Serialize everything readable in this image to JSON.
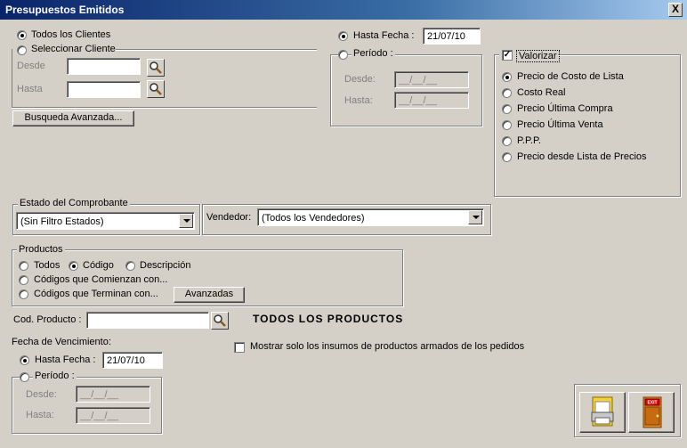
{
  "window": {
    "title": "Presupuestos Emitidos",
    "close_label": "X"
  },
  "cliente": {
    "todos_label": "Todos los Clientes",
    "seleccionar_label": "Seleccionar Cliente",
    "desde_label": "Desde",
    "hasta_label": "Hasta",
    "desde_value": "",
    "hasta_value": "",
    "busqueda_button": "Busqueda Avanzada..."
  },
  "fecha": {
    "hasta_fecha_label": "Hasta Fecha :",
    "hasta_fecha_value": "21/07/10",
    "periodo_label": "Período :",
    "desde_label": "Desde:",
    "hasta_label": "Hasta:",
    "desde_value": "__/__/__",
    "hasta_value": "__/__/__"
  },
  "valorizar": {
    "label": "Valorizar",
    "checked": true,
    "options": [
      "Precio de Costo de Lista",
      "Costo Real",
      "Precio Última Compra",
      "Precio Última Venta",
      "P.P.P.",
      "Precio desde Lista de Precios"
    ],
    "selected": "Precio de Costo de Lista"
  },
  "estado": {
    "label": "Estado del Comprobante",
    "value": "(Sin Filtro Estados)"
  },
  "vendedor": {
    "label": "Vendedor:",
    "value": "(Todos los Vendedores)"
  },
  "productos": {
    "label": "Productos",
    "todos_label": "Todos",
    "codigo_label": "Código",
    "descripcion_label": "Descripción",
    "comienzan_label": "Códigos que Comienzan con...",
    "terminan_label": "Códigos que Terminan con...",
    "avanzadas_button": "Avanzadas",
    "selected": "Código"
  },
  "cod_producto": {
    "label": "Cod. Producto :",
    "value": "",
    "banner": "TODOS LOS PRODUCTOS"
  },
  "vencimiento": {
    "label": "Fecha de Vencimiento:",
    "hasta_fecha_label": "Hasta Fecha :",
    "hasta_fecha_value": "21/07/10",
    "periodo_label": "Período :",
    "desde_label": "Desde:",
    "hasta_label": "Hasta:",
    "desde_value": "__/__/__",
    "hasta_value": "__/__/__"
  },
  "insumos": {
    "label": "Mostrar solo los insumos de productos armados de los pedidos",
    "checked": false
  },
  "actions": {
    "exit_label": "EXIT"
  }
}
